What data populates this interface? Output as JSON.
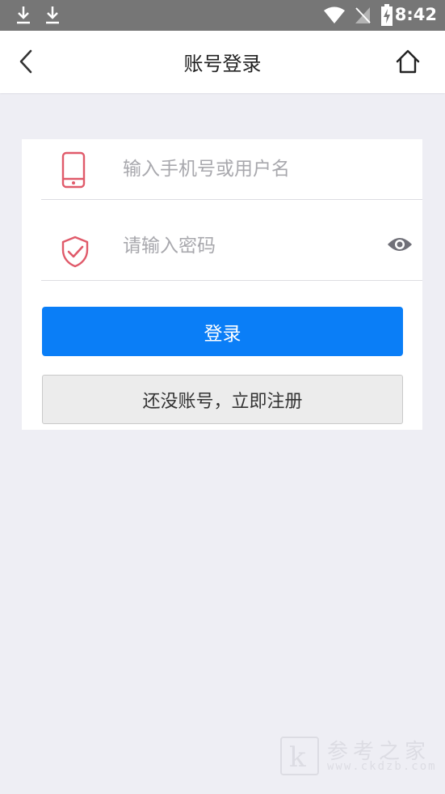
{
  "status_bar": {
    "time": "8:42"
  },
  "nav": {
    "title": "账号登录"
  },
  "form": {
    "phone_placeholder": "输入手机号或用户名",
    "password_placeholder": "请输入密码",
    "login_label": "登录",
    "register_label": "还没账号，立即注册"
  },
  "watermark": {
    "brand": "参考之家",
    "url": "www.ckdzb.com",
    "logo_letter": "k"
  },
  "colors": {
    "primary": "#0a7ef7",
    "icon_red": "#e05a6a",
    "background": "#eeeef4"
  }
}
